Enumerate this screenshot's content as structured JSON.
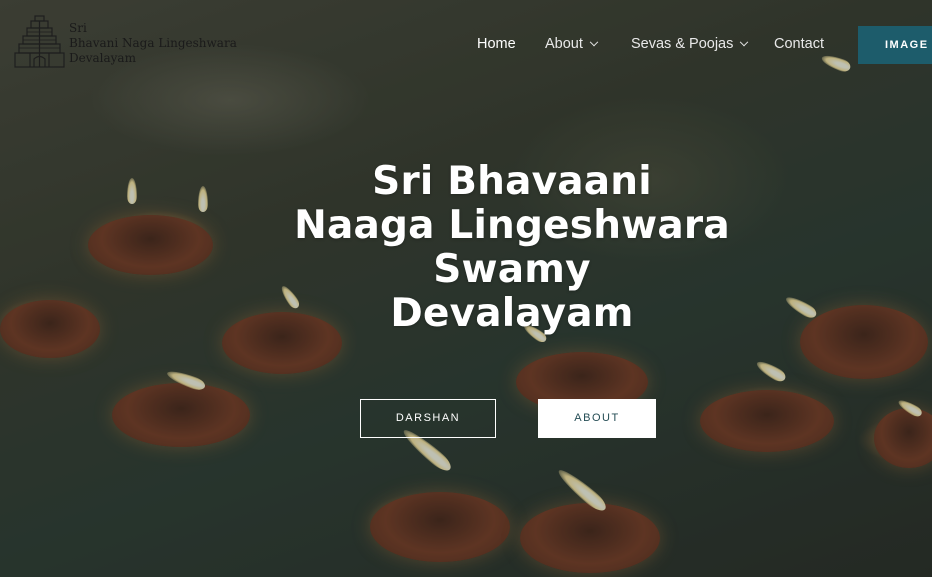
{
  "site": {
    "logo_lines": [
      "Sri",
      "Bhavani Naga Lingeshwara",
      "Devalayam"
    ]
  },
  "nav": {
    "home": "Home",
    "about": "About",
    "sevas": "Sevas & Poojas",
    "contact": "Contact",
    "images": "IMAGE"
  },
  "hero": {
    "title_lines": [
      "Sri Bhavaani",
      "Naaga Lingeshwara",
      "Swamy",
      "Devalayam"
    ],
    "darshan_label": "DARSHAN",
    "about_label": "ABOUT"
  },
  "colors": {
    "accent": "#1d5c6b",
    "about_text": "#254d55"
  }
}
